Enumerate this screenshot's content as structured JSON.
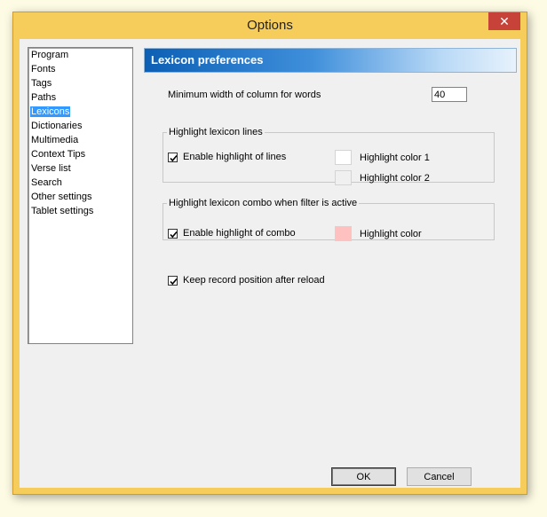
{
  "window": {
    "title": "Options",
    "close_glyph": "✕",
    "close_icon": "close-icon",
    "frame_color": "#f6cd5a"
  },
  "sidebar": {
    "items": [
      {
        "label": "Program"
      },
      {
        "label": "Fonts"
      },
      {
        "label": "Tags"
      },
      {
        "label": "Paths"
      },
      {
        "label": "Lexicons",
        "selected": true
      },
      {
        "label": "Dictionaries"
      },
      {
        "label": "Multimedia"
      },
      {
        "label": "Context Tips"
      },
      {
        "label": "Verse list"
      },
      {
        "label": "Search"
      },
      {
        "label": "Other settings"
      },
      {
        "label": "Tablet settings"
      }
    ]
  },
  "panel": {
    "header": "Lexicon preferences",
    "min_width_label": "Minimum width of column for words",
    "min_width_value": "40",
    "highlight_lines": {
      "title": "Highlight lexicon lines",
      "enable_label": "Enable highlight of lines",
      "enable_checked": true,
      "color1_label": "Highlight color 1",
      "color1": "#ffffff",
      "color2_label": "Highlight color 2",
      "color2": "#f0f0f0"
    },
    "highlight_combo": {
      "title": "Highlight lexicon combo when filter is active",
      "enable_label": "Enable highlight of combo",
      "enable_checked": true,
      "color_label": "Highlight color",
      "color": "#ffc0c0"
    },
    "keep_position_label": "Keep record position after reload",
    "keep_position_checked": true
  },
  "buttons": {
    "ok": "OK",
    "cancel": "Cancel"
  }
}
